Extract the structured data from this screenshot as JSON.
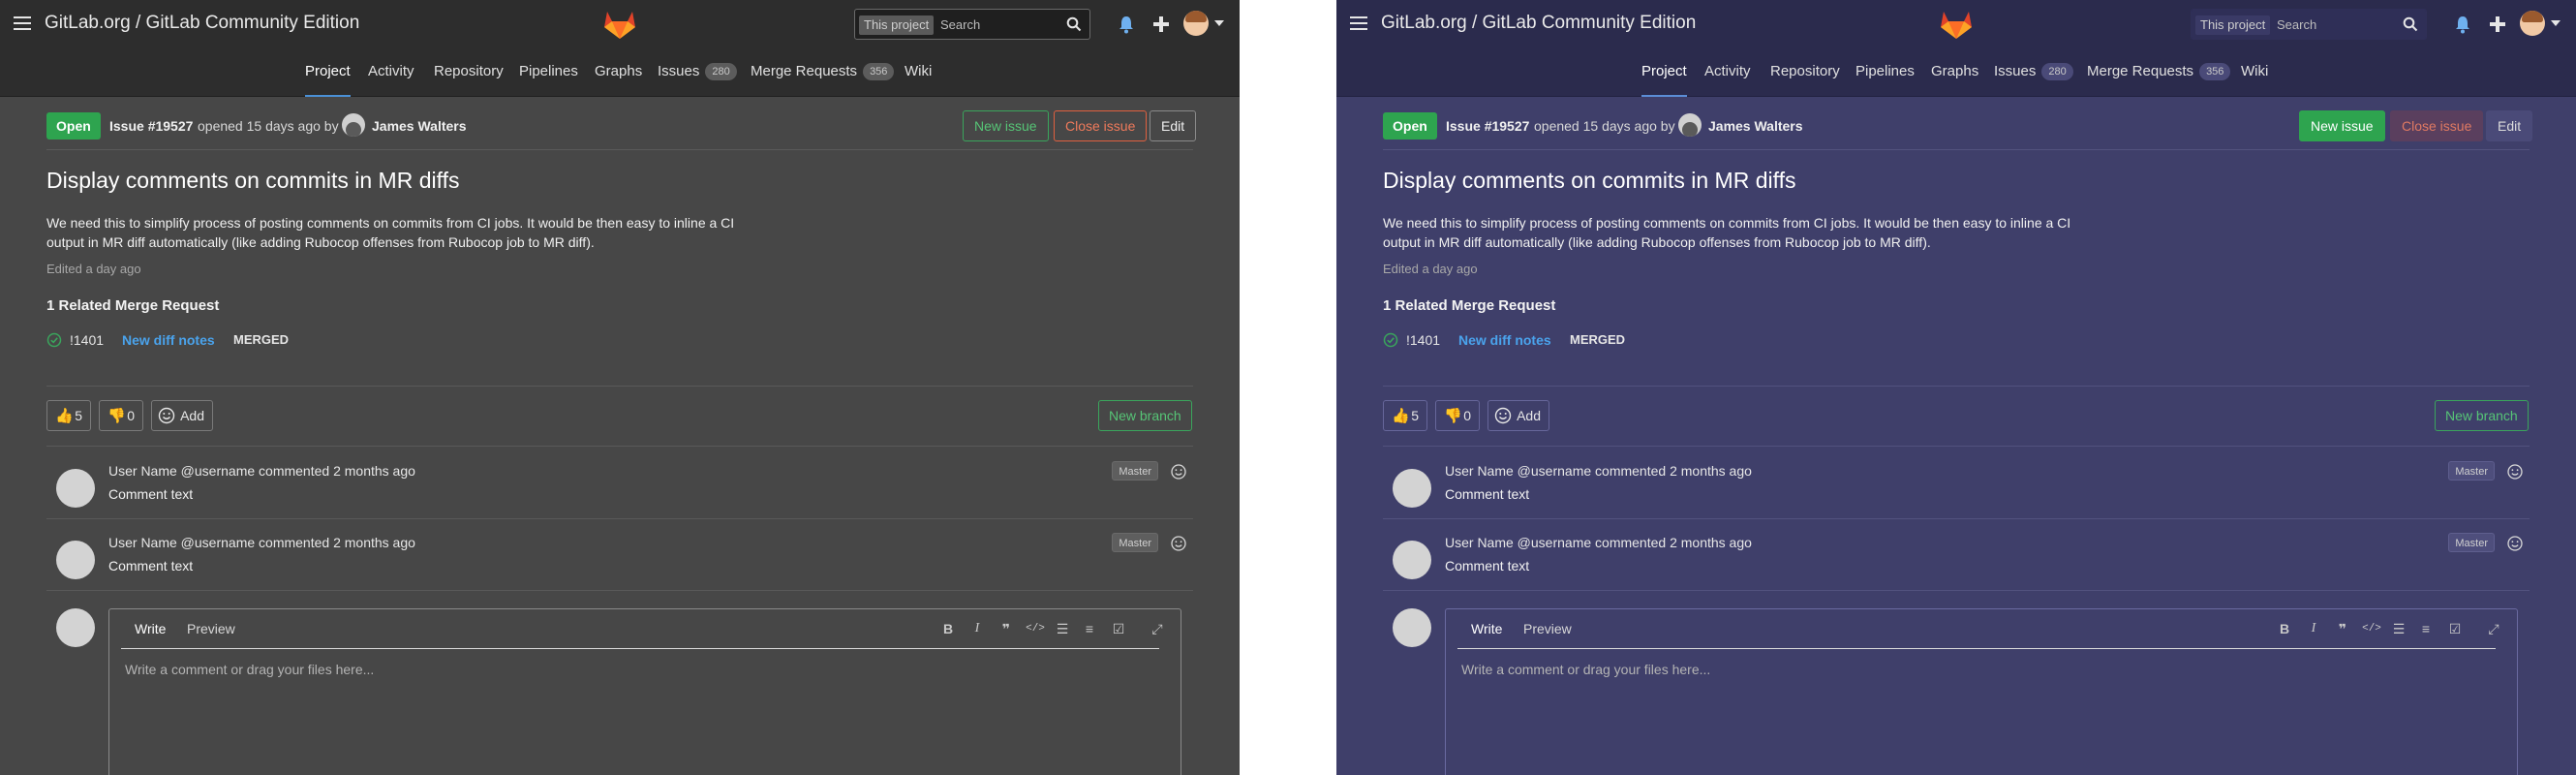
{
  "header": {
    "brand": "GitLab.org / GitLab Community Edition",
    "search_scope": "This project",
    "search_placeholder": "Search"
  },
  "nav": {
    "project": "Project",
    "activity": "Activity",
    "repository": "Repository",
    "pipelines": "Pipelines",
    "graphs": "Graphs",
    "issues": "Issues",
    "issues_count": "280",
    "merge_requests": "Merge Requests",
    "mr_count": "356",
    "wiki": "Wiki"
  },
  "issue": {
    "status": "Open",
    "number": "Issue #19527",
    "opened": "opened 15 days ago by",
    "author": "James Walters",
    "title": "Display comments on commits in MR diffs",
    "description": "We need this to simplify process of posting comments on commits from CI jobs. It would be then easy to inline a CI output in MR diff automatically (like adding Rubocop offenses from Rubocop job to MR diff).",
    "edited": "Edited a day ago"
  },
  "actions": {
    "new_issue": "New issue",
    "close_issue": "Close issue",
    "edit": "Edit"
  },
  "related": {
    "heading": "1 Related Merge Request",
    "mr_id": "!1401",
    "mr_title": "New diff notes",
    "mr_state": "MERGED"
  },
  "awards": {
    "thumbsup": "5",
    "thumbsdown": "0",
    "add": "Add",
    "new_branch": "New branch"
  },
  "notes": [
    {
      "author": "User Name @username commented 2 months ago",
      "text": "Comment text",
      "role": "Master"
    },
    {
      "author": "User Name @username commented 2 months ago",
      "text": "Comment text",
      "role": "Master"
    }
  ],
  "editor": {
    "write": "Write",
    "preview": "Preview",
    "placeholder": "Write a comment or drag your files here..."
  },
  "themes": {
    "dark_gray_bg": "#474747",
    "dark_blue_bg": "#3f3f6a",
    "accent_green": "#2ea44f",
    "link_blue": "#4aa3ec"
  }
}
